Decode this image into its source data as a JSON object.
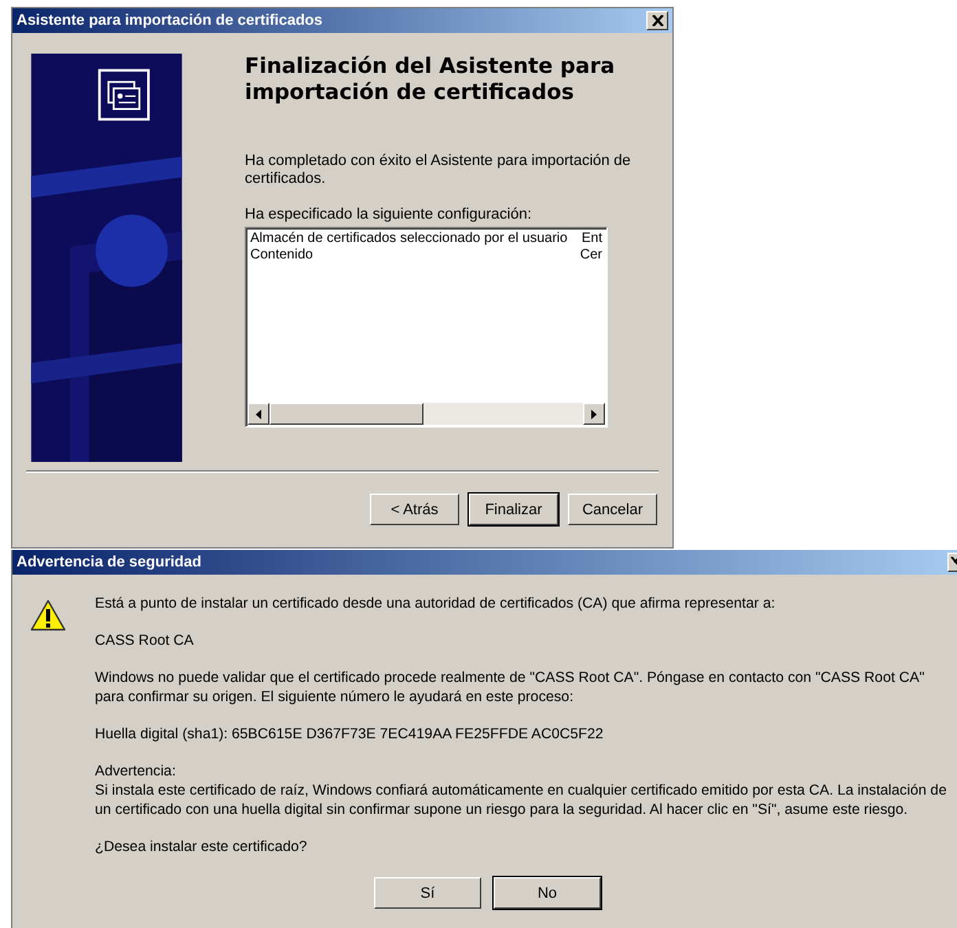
{
  "wizard": {
    "title": "Asistente para importación de certificados",
    "heading": [
      "Finalización del Asistente para",
      "importación de certificados"
    ],
    "intro": [
      "Ha completado con éxito el Asistente para importación de",
      "certificados."
    ],
    "list_label": "Ha especificado la siguiente configuración:",
    "settings": [
      {
        "name": "Almacén de certificados seleccionado por el usuario",
        "value": "Ent"
      },
      {
        "name": "Contenido",
        "value": "Cer"
      }
    ],
    "buttons": [
      {
        "label": "< Atrás",
        "default": false
      },
      {
        "label": "Finalizar",
        "default": true
      },
      {
        "label": "Cancelar",
        "default": false
      }
    ]
  },
  "warning": {
    "title": "Advertencia de seguridad",
    "paragraphs": [
      [
        "Está a punto de instalar un certificado desde una autoridad de certificados (CA) que afirma representar a:"
      ],
      [
        "CASS Root CA"
      ],
      [
        "Windows no puede validar que el certificado procede realmente de \"CASS Root CA\". Póngase en contacto con \"CASS Root CA\"",
        "para confirmar su origen. El siguiente número le ayudará en este proceso:"
      ],
      [
        "Huella digital (sha1): 65BC615E D367F73E 7EC419AA FE25FFDE AC0C5F22"
      ],
      [
        "Advertencia:",
        "Si instala este certificado de raíz, Windows confiará automáticamente en cualquier certificado emitido por esta CA. La instalación de",
        "un certificado con una huella digital sin confirmar supone un riesgo para la seguridad. Al hacer clic en \"Sí\", asume este riesgo."
      ],
      [
        "¿Desea instalar este certificado?"
      ]
    ],
    "buttons": [
      {
        "label": "Sí",
        "default": false
      },
      {
        "label": "No",
        "default": true
      }
    ]
  }
}
